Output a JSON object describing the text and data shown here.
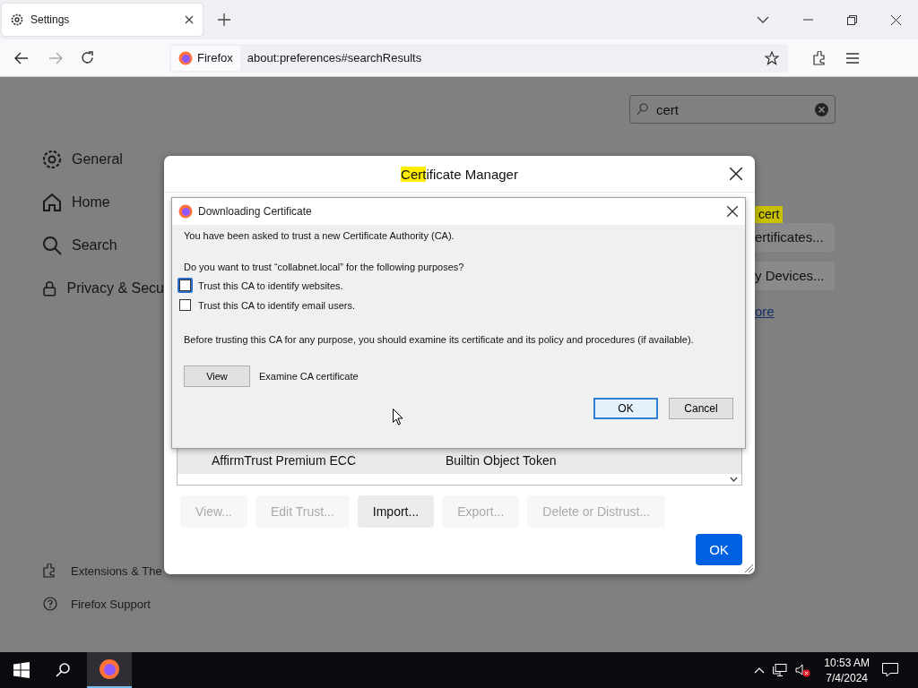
{
  "browser": {
    "tab": {
      "title": "Settings"
    },
    "identity": "Firefox",
    "url": "about:preferences#searchResults"
  },
  "search": {
    "value": "cert"
  },
  "sidebar": {
    "items": [
      "General",
      "Home",
      "Search",
      "Privacy & Secu"
    ],
    "footer_items": [
      "Extensions & The",
      "Firefox Support"
    ]
  },
  "page_fragments": {
    "highlight": "cert",
    "buttons": [
      "ertificates...",
      "y Devices..."
    ],
    "link": "ore"
  },
  "certificate_manager": {
    "title_highlight": "Cert",
    "title_rest": "ificate Manager",
    "rows": [
      {
        "name": "AffirmTrust Premium ECC",
        "token": "Builtin Object Token"
      }
    ],
    "buttons": [
      {
        "label": "View...",
        "disabled": true
      },
      {
        "label": "Edit Trust...",
        "disabled": true
      },
      {
        "label": "Import...",
        "disabled": false
      },
      {
        "label": "Export...",
        "disabled": true
      },
      {
        "label": "Delete or Distrust...",
        "disabled": true
      }
    ],
    "ok": "OK"
  },
  "download_dialog": {
    "title": "Downloading Certificate",
    "intro": "You have been asked to trust a new Certificate Authority (CA).",
    "question": "Do you want to trust “collabnet.local” for the following purposes?",
    "options": [
      {
        "label": "Trust this CA to identify websites.",
        "checked": false,
        "focused": true
      },
      {
        "label": "Trust this CA to identify email users.",
        "checked": false,
        "focused": false
      }
    ],
    "advice": "Before trusting this CA for any purpose, you should examine its certificate and its policy and procedures (if available).",
    "view_button": "View",
    "view_label": "Examine CA certificate",
    "buttons": [
      {
        "label": "OK",
        "default": true
      },
      {
        "label": "Cancel",
        "default": false
      }
    ]
  },
  "taskbar": {
    "time": "10:53 AM",
    "date": "7/4/2024"
  }
}
